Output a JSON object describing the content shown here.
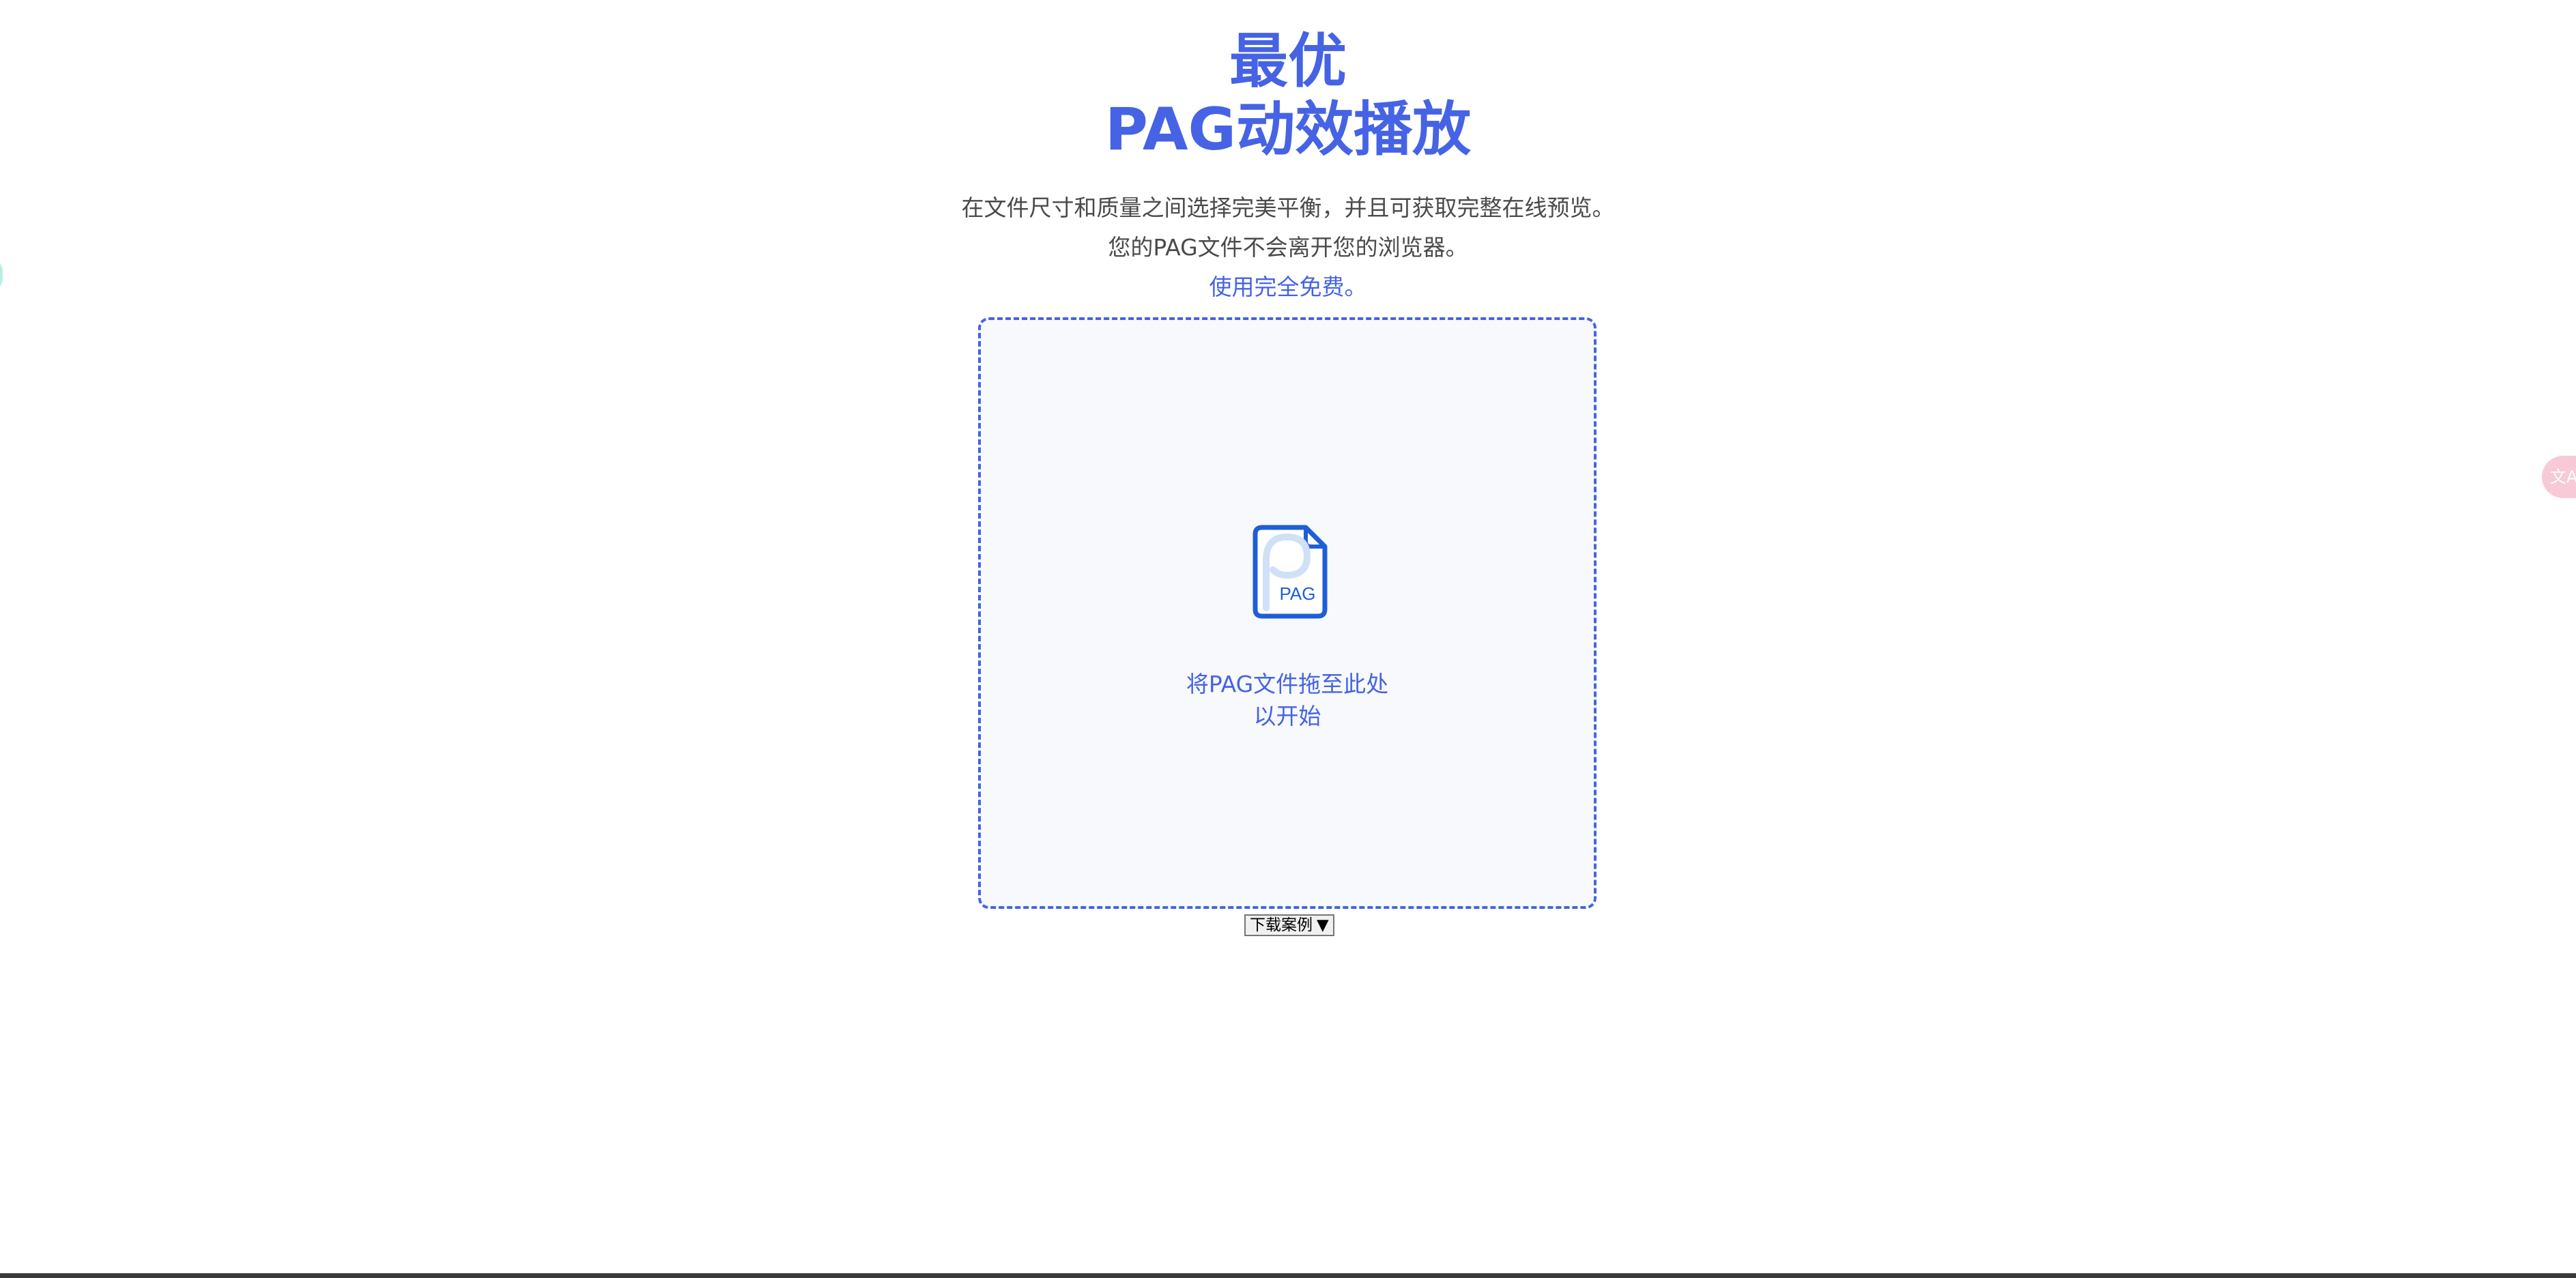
{
  "hero": {
    "title_line1": "最优",
    "title_line2": "PAG动效播放",
    "subtitle_line1": "在文件尺寸和质量之间选择完美平衡，并且可获取完整在线预览。",
    "subtitle_line2": "您的PAG文件不会离开您的浏览器。",
    "free_text": "使用完全免费。"
  },
  "dropzone": {
    "icon": "pag-file-icon",
    "icon_label": "PAG",
    "text_line1": "将PAG文件拖至此处",
    "text_line2": "以开始"
  },
  "download": {
    "selected_label": "下载案例",
    "arrow": "▼"
  },
  "floating": {
    "translate_icon": "translate-icon",
    "translate_glyph": "文A"
  },
  "colors": {
    "accent": "#4563e4",
    "dropzone_bg": "#f7f9fc",
    "icon_blue": "#1f5fd6",
    "icon_light": "#cfe0f7"
  }
}
